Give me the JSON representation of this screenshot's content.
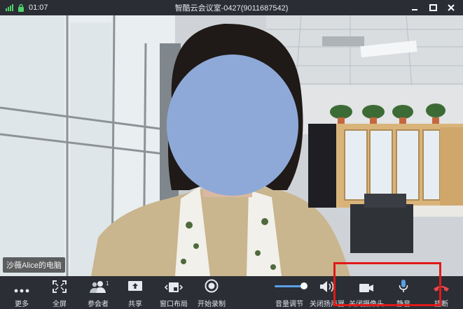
{
  "titlebar": {
    "time": "01:07",
    "title": "智酷云会议室-0427(9011687542)"
  },
  "video": {
    "participant_name": "沙薇Alice的电脑"
  },
  "toolbar": {
    "more": "更多",
    "fullscreen": "全屏",
    "participants": "参会者",
    "participants_count": "1",
    "share": "共享",
    "layout": "窗口布局",
    "record": "开始录制",
    "volume": "音量调节",
    "speaker": "关闭扬声器",
    "camera": "关闭摄像头",
    "mute": "静音",
    "hangup": "挂断"
  },
  "colors": {
    "toolbar_bg": "#2b2e34",
    "accent": "#5aa0e8",
    "hangup": "#e5484d",
    "highlight": "#e11919",
    "face_mask": "#8ea9d8"
  }
}
